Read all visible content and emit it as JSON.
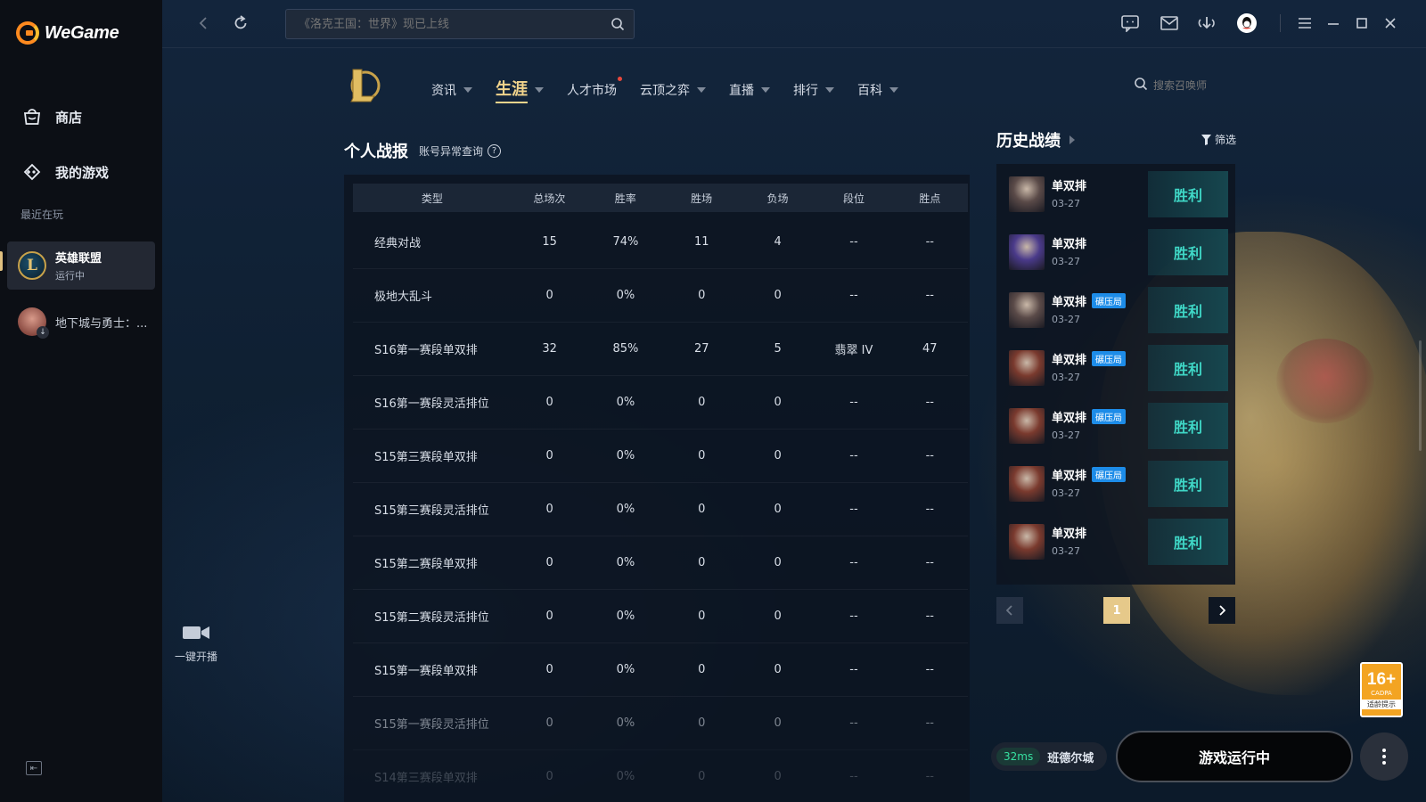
{
  "app": {
    "name": "WeGame"
  },
  "sidebar": {
    "items": [
      {
        "label": "商店",
        "icon": "store-bag-icon"
      },
      {
        "label": "我的游戏",
        "icon": "game-controller-icon"
      }
    ],
    "recent_title": "最近在玩",
    "recent_games": [
      {
        "name": "英雄联盟",
        "status": "运行中",
        "icon": "lol-logo-icon",
        "active": true
      },
      {
        "name": "地下城与勇士：...",
        "icon": "dnf-logo-icon"
      }
    ]
  },
  "topbar": {
    "search_placeholder": "《洛克王国：世界》现已上线",
    "icons": [
      "back-icon",
      "refresh-icon",
      "search-icon",
      "chat-icon",
      "mail-icon",
      "download-icon",
      "avatar",
      "menu-icon",
      "minimize-icon",
      "maximize-icon",
      "close-icon"
    ]
  },
  "game_nav": {
    "items": [
      {
        "label": "资讯",
        "caret": true
      },
      {
        "label": "生涯",
        "caret": true,
        "active": true
      },
      {
        "label": "人才市场",
        "caret": false,
        "dot": true
      },
      {
        "label": "云顶之弈",
        "caret": true
      },
      {
        "label": "直播",
        "caret": true
      },
      {
        "label": "排行",
        "caret": true
      },
      {
        "label": "百科",
        "caret": true
      }
    ],
    "summoner_search_placeholder": "搜索召唤师"
  },
  "record": {
    "title": "个人战报",
    "link": "账号异常查询",
    "columns": [
      "类型",
      "总场次",
      "胜率",
      "胜场",
      "负场",
      "段位",
      "胜点"
    ],
    "rows": [
      [
        "经典对战",
        "15",
        "74%",
        "11",
        "4",
        "--",
        "--"
      ],
      [
        "极地大乱斗",
        "0",
        "0%",
        "0",
        "0",
        "--",
        "--"
      ],
      [
        "S16第一赛段单双排",
        "32",
        "85%",
        "27",
        "5",
        "翡翠 IV",
        "47"
      ],
      [
        "S16第一赛段灵活排位",
        "0",
        "0%",
        "0",
        "0",
        "--",
        "--"
      ],
      [
        "S15第三赛段单双排",
        "0",
        "0%",
        "0",
        "0",
        "--",
        "--"
      ],
      [
        "S15第三赛段灵活排位",
        "0",
        "0%",
        "0",
        "0",
        "--",
        "--"
      ],
      [
        "S15第二赛段单双排",
        "0",
        "0%",
        "0",
        "0",
        "--",
        "--"
      ],
      [
        "S15第二赛段灵活排位",
        "0",
        "0%",
        "0",
        "0",
        "--",
        "--"
      ],
      [
        "S15第一赛段单双排",
        "0",
        "0%",
        "0",
        "0",
        "--",
        "--"
      ],
      [
        "S15第一赛段灵活排位",
        "0",
        "0%",
        "0",
        "0",
        "--",
        "--"
      ],
      [
        "S14第三赛段单双排",
        "0",
        "0%",
        "0",
        "0",
        "--",
        "--"
      ]
    ]
  },
  "history": {
    "title": "历史战绩",
    "filter_label": "筛选",
    "matches": [
      {
        "mode": "单双排",
        "date": "03-27",
        "result": "胜利",
        "badge": "",
        "champ_color": "#5a4a48"
      },
      {
        "mode": "单双排",
        "date": "03-27",
        "result": "胜利",
        "badge": "",
        "champ_color": "#4a3a8a"
      },
      {
        "mode": "单双排",
        "date": "03-27",
        "result": "胜利",
        "badge": "碾压局",
        "champ_color": "#5a4a48"
      },
      {
        "mode": "单双排",
        "date": "03-27",
        "result": "胜利",
        "badge": "碾压局",
        "champ_color": "#7a3a2e"
      },
      {
        "mode": "单双排",
        "date": "03-27",
        "result": "胜利",
        "badge": "碾压局",
        "champ_color": "#7a3a2e"
      },
      {
        "mode": "单双排",
        "date": "03-27",
        "result": "胜利",
        "badge": "碾压局",
        "champ_color": "#7a3a2e"
      },
      {
        "mode": "单双排",
        "date": "03-27",
        "result": "胜利",
        "badge": "",
        "champ_color": "#7a3a2e"
      }
    ],
    "page": "1"
  },
  "stream": {
    "label": "一键开播"
  },
  "age_rating": {
    "value": "16+",
    "org": "CADPA",
    "tip": "适龄提示"
  },
  "bottom": {
    "ping": "32ms",
    "server": "班德尔城",
    "play_label": "游戏运行中"
  },
  "colors": {
    "accent_gold": "#f1d48c",
    "win_teal": "#3fd7c6",
    "badge_blue": "#1d8ce8",
    "ping_green": "#36e0a0"
  }
}
